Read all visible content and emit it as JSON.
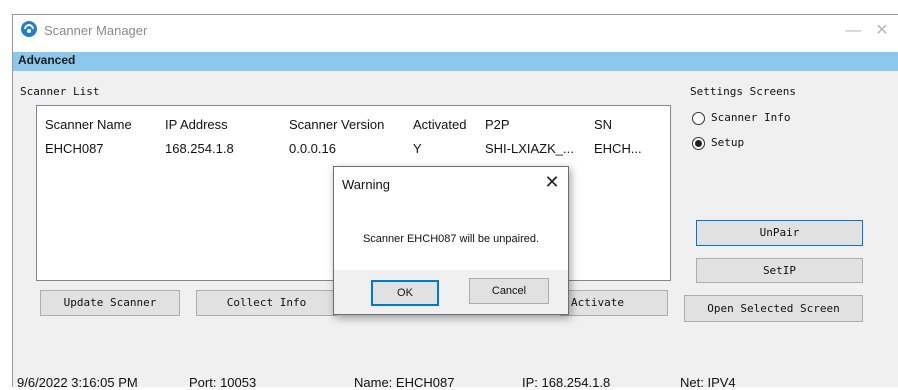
{
  "window": {
    "title": "Scanner Manager",
    "minimize_icon": "—",
    "close_icon": "✕"
  },
  "menu": {
    "advanced": "Advanced"
  },
  "scanner_list": {
    "label": "Scanner List",
    "columns": [
      "Scanner Name",
      "IP Address",
      "Scanner Version",
      "Activated",
      "P2P",
      "SN"
    ],
    "rows": [
      [
        "EHCH087",
        "168.254.1.8",
        "0.0.0.16",
        "Y",
        "SHI-LXIAZK_...",
        "EHCH..."
      ]
    ]
  },
  "settings": {
    "label": "Settings Screens",
    "options": [
      {
        "label": "Scanner Info",
        "selected": false
      },
      {
        "label": "Setup",
        "selected": true
      }
    ],
    "unpair_button": "UnPair",
    "setip_button": "SetIP",
    "open_selected_button": "Open Selected Screen"
  },
  "bottom_buttons": {
    "update_scanner": "Update Scanner",
    "collect_info": "Collect Info",
    "activate": "Activate"
  },
  "status_bar": {
    "datetime": "9/6/2022 3:16:05 PM",
    "port": "Port: 10053",
    "name": "Name: EHCH087",
    "ip": "IP: 168.254.1.8",
    "net": "Net: IPV4"
  },
  "dialog": {
    "title": "Warning",
    "close_icon": "✕",
    "message": "Scanner EHCH087 will be unpaired.",
    "ok": "OK",
    "cancel": "Cancel"
  },
  "colors": {
    "menubar": "#8cc7ec",
    "focus_border": "#0078d7",
    "app_icon": "#1f7ed6"
  }
}
